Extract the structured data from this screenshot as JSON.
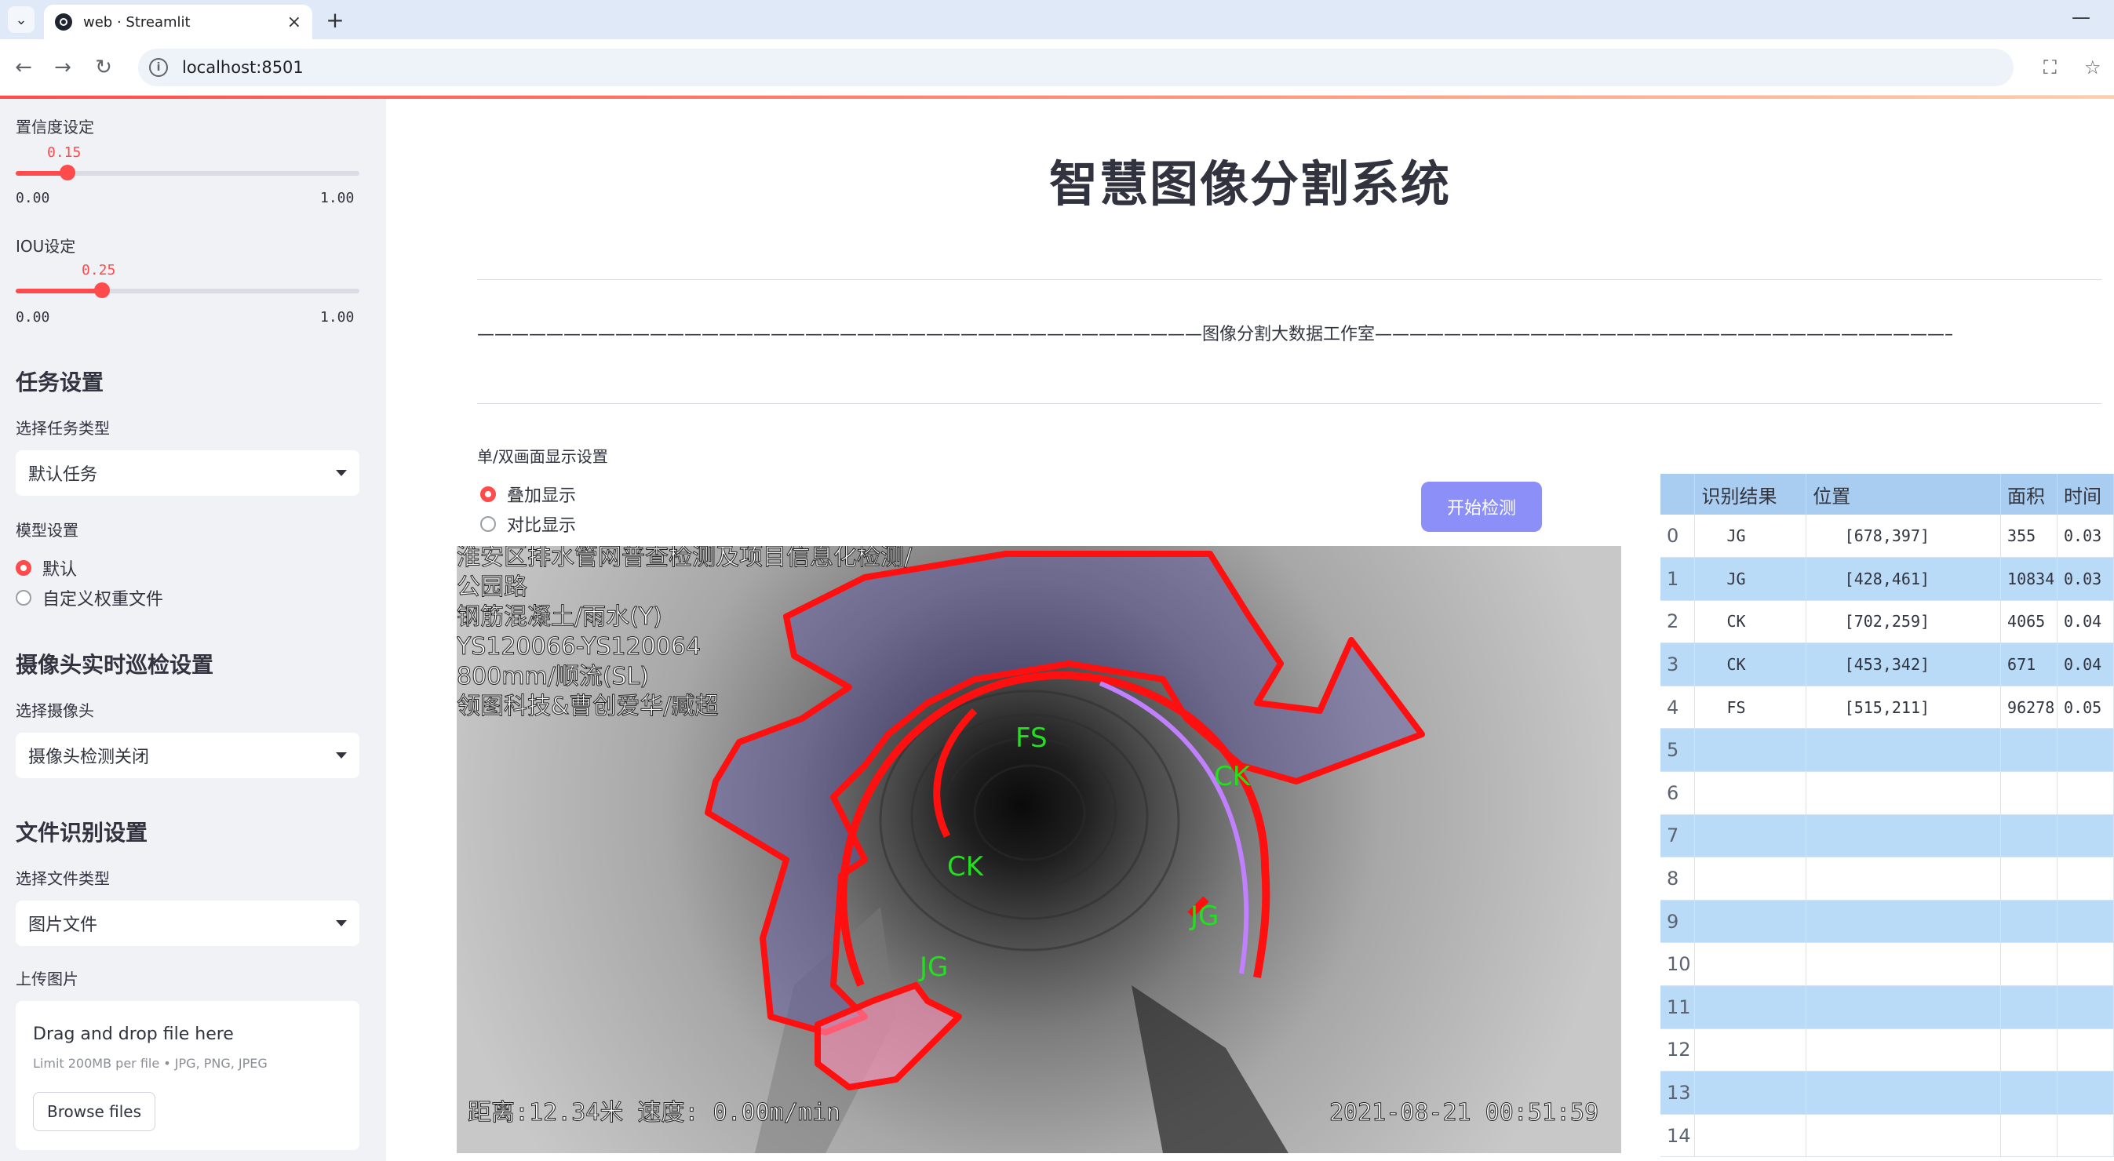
{
  "browser": {
    "tab_title": "web · Streamlit",
    "url": "localhost:8501"
  },
  "sidebar": {
    "confidence": {
      "label": "置信度设定",
      "value_text": "0.15",
      "value": 0.15,
      "min": "0.00",
      "max": "1.00"
    },
    "iou": {
      "label": "IOU设定",
      "value_text": "0.25",
      "value": 0.25,
      "min": "0.00",
      "max": "1.00"
    },
    "task_heading": "任务设置",
    "task_type_label": "选择任务类型",
    "task_type_value": "默认任务",
    "model_label": "模型设置",
    "model_options": [
      "默认",
      "自定义权重文件"
    ],
    "camera_heading": "摄像头实时巡检设置",
    "camera_label": "选择摄像头",
    "camera_value": "摄像头检测关闭",
    "file_heading": "文件识别设置",
    "file_type_label": "选择文件类型",
    "file_type_value": "图片文件",
    "upload_label": "上传图片",
    "upload_title": "Drag and drop file here",
    "upload_limit": "Limit 200MB per file • JPG, PNG, JPEG",
    "browse_label": "Browse files"
  },
  "main": {
    "title": "智慧图像分割系统",
    "studio_line": "——————————————————————————————————————————图像分割大数据工作室——————————————————————————————————————————",
    "display_label": "单/双画面显示设置",
    "display_options": [
      "叠加显示",
      "对比显示"
    ],
    "start_button": "开始检测"
  },
  "image": {
    "overlay_lines": [
      "淮安区排水管网普查检测及项目信息化检测/",
      "公园路",
      "钢筋混凝土/雨水(Y)",
      "YS120066-YS120064",
      "800mm/顺流(SL)",
      "领图科技&曹创爱华/臧超"
    ],
    "bottom_left": "距离:12.34米 速度: 0.00m/min",
    "bottom_right": "2021-08-21 00:51:59",
    "labels": [
      "FS",
      "CK",
      "CK",
      "JG",
      "JG"
    ]
  },
  "table": {
    "headers": [
      "",
      "识别结果",
      "位置",
      "面积",
      "时间"
    ],
    "rows": [
      [
        "0",
        "JG",
        "[678,397]",
        "355",
        "0.03"
      ],
      [
        "1",
        "JG",
        "[428,461]",
        "10834",
        "0.03"
      ],
      [
        "2",
        "CK",
        "[702,259]",
        "4065",
        "0.04"
      ],
      [
        "3",
        "CK",
        "[453,342]",
        "671",
        "0.04"
      ],
      [
        "4",
        "FS",
        "[515,211]",
        "96278",
        "0.05"
      ],
      [
        "5",
        "",
        "",
        "",
        ""
      ],
      [
        "6",
        "",
        "",
        "",
        ""
      ],
      [
        "7",
        "",
        "",
        "",
        ""
      ],
      [
        "8",
        "",
        "",
        "",
        ""
      ],
      [
        "9",
        "",
        "",
        "",
        ""
      ],
      [
        "10",
        "",
        "",
        "",
        ""
      ],
      [
        "11",
        "",
        "",
        "",
        ""
      ],
      [
        "12",
        "",
        "",
        "",
        ""
      ],
      [
        "13",
        "",
        "",
        "",
        ""
      ],
      [
        "14",
        "",
        "",
        "",
        ""
      ]
    ]
  }
}
